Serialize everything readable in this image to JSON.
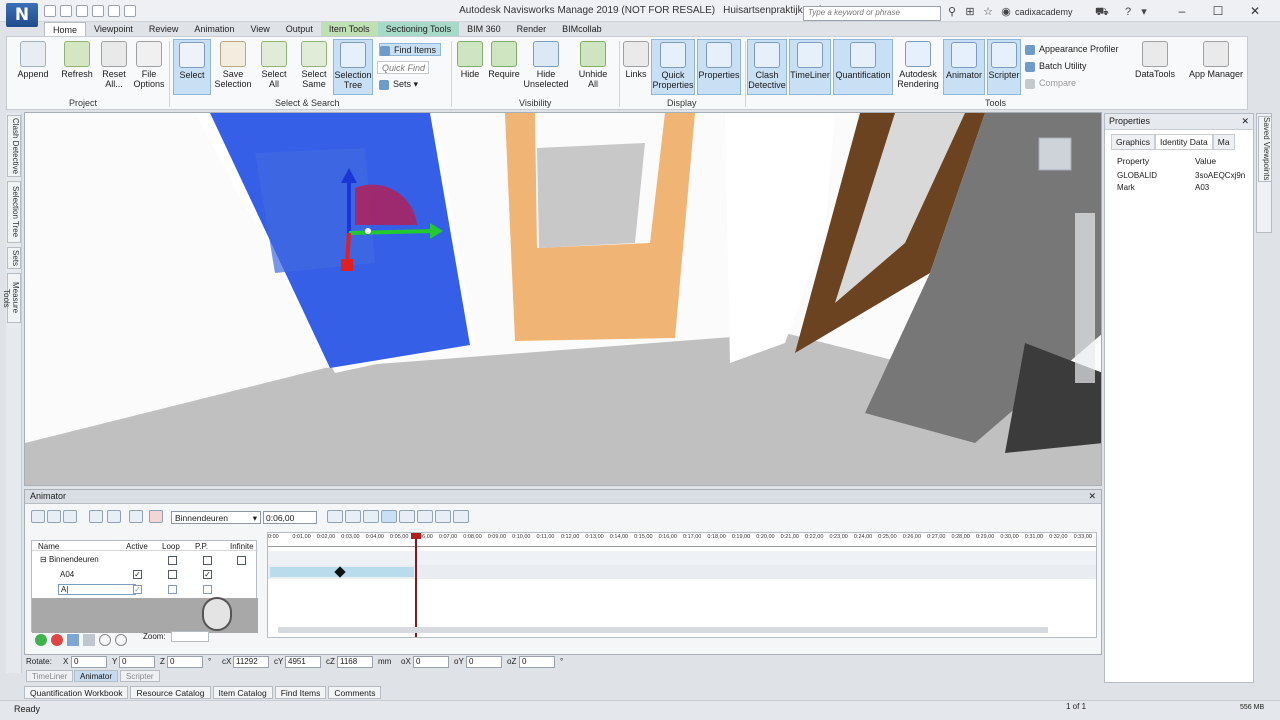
{
  "app": {
    "logo": "N",
    "title": "Autodesk Navisworks Manage 2019 (NOT FOR RESALE)",
    "file": "Huisartsenpraktijk.nwf",
    "search_placeholder": "Type a keyword or phrase",
    "user": "cadixacademy"
  },
  "tabs": [
    "Home",
    "Viewpoint",
    "Review",
    "Animation",
    "View",
    "Output",
    "Item Tools",
    "Sectioning Tools",
    "BIM 360",
    "Render",
    "BIMcollab"
  ],
  "ribbon": {
    "project": {
      "label": "Project",
      "buttons": [
        "Append",
        "Refresh",
        "Reset All...",
        "File Options"
      ]
    },
    "select_search": {
      "label": "Select & Search",
      "buttons": [
        "Select",
        "Save Selection",
        "Select All",
        "Select Same",
        "Selection Tree"
      ],
      "find_items": "Find Items",
      "quick_find": "Quick Find",
      "sets": "Sets"
    },
    "visibility": {
      "label": "Visibility",
      "buttons": [
        "Hide",
        "Require",
        "Hide Unselected",
        "Unhide All"
      ]
    },
    "display": {
      "label": "Display",
      "buttons": [
        "Links",
        "Quick Properties",
        "Properties"
      ]
    },
    "tools": {
      "label": "Tools",
      "buttons": [
        "Clash Detective",
        "TimeLiner",
        "Quantification",
        "Autodesk Rendering",
        "Animator",
        "Scripter",
        "DataTools",
        "App Manager"
      ],
      "small": [
        "Appearance Profiler",
        "Batch Utility",
        "Compare"
      ]
    }
  },
  "left_tabs": [
    "Clash Detective",
    "Selection Tree",
    "Sets",
    "Measure Tools"
  ],
  "right_tabs": [
    "Saved Viewpoints"
  ],
  "properties": {
    "title": "Properties",
    "tabs": [
      "Graphics",
      "Identity Data",
      "Ma"
    ],
    "headers": [
      "Property",
      "Value"
    ],
    "rows": [
      {
        "property": "GLOBALID",
        "value": "3soAEQCxj9n"
      },
      {
        "property": "Mark",
        "value": "A03"
      }
    ]
  },
  "animator": {
    "title": "Animator",
    "scene_select": "Binnendeuren",
    "time": "0:06,00",
    "columns": [
      "Name",
      "Active",
      "Loop",
      "P.P.",
      "Infinite"
    ],
    "tree": [
      {
        "name": "Binnendeuren",
        "active": false,
        "loop": false,
        "pp": false,
        "infinite": false
      },
      {
        "name": "A04",
        "active": true,
        "loop": false,
        "pp": true
      },
      {
        "name": "A|",
        "active": true,
        "loop": false,
        "pp": false
      }
    ],
    "zoom_label": "Zoom:",
    "timeline_ticks": [
      "0:00",
      "0:01,00",
      "0:02,00",
      "0:03,00",
      "0:04,00",
      "0:05,00",
      "0:06,00",
      "0:07,00",
      "0:08,00",
      "0:09,00",
      "0:10,00",
      "0:11,00",
      "0:12,00",
      "0:13,00",
      "0:14,00",
      "0:15,00",
      "0:16,00",
      "0:17,00",
      "0:18,00",
      "0:19,00",
      "0:20,00",
      "0:21,00",
      "0:22,00",
      "0:23,00",
      "0:24,00",
      "0:25,00",
      "0:26,00",
      "0:27,00",
      "0:28,00",
      "0:29,00",
      "0:30,00",
      "0:31,00",
      "0:32,00",
      "0:33,00"
    ]
  },
  "rotate": {
    "label": "Rotate:",
    "x": "0",
    "y": "0",
    "z": "0",
    "deg": "°",
    "cx": "11292",
    "cy": "4951",
    "cz": "1168",
    "unit": "mm",
    "ox": "0",
    "oy": "0",
    "oz": "0"
  },
  "bottom_tabs": [
    "TimeLiner",
    "Animator",
    "Scripter"
  ],
  "workbook_tabs": [
    "Quantification Workbook",
    "Resource Catalog",
    "Item Catalog",
    "Find Items",
    "Comments"
  ],
  "status": {
    "text": "Ready",
    "page": "1 of 1",
    "memory": "556 MB"
  }
}
